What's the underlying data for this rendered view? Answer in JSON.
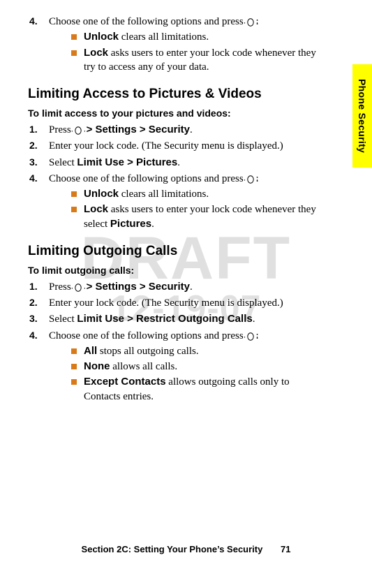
{
  "sideTab": "Phone Security",
  "watermark": {
    "line1": "DRAFT",
    "line2": "12-19-07"
  },
  "topBlock": {
    "step4": {
      "num": "4.",
      "text": "Choose one of the following options and press ",
      "after": ":"
    },
    "bullets": [
      {
        "bold": "Unlock",
        "rest": " clears all limitations."
      },
      {
        "bold": "Lock",
        "rest": " asks users to enter your lock code whenever they try to access any of your data."
      }
    ]
  },
  "sectionA": {
    "heading": "Limiting Access to Pictures & Videos",
    "subhead": "To limit access to your pictures and videos:",
    "steps": {
      "s1": {
        "num": "1.",
        "pre": "Press ",
        "path": " > Settings > Security",
        "end": "."
      },
      "s2": {
        "num": "2.",
        "text": "Enter your lock code. (The Security menu is displayed.)"
      },
      "s3": {
        "num": "3.",
        "pre": "Select ",
        "bold": "Limit Use > Pictures",
        "end": "."
      },
      "s4": {
        "num": "4.",
        "text": "Choose one of the following options and press ",
        "after": ":"
      }
    },
    "bullets": [
      {
        "bold": "Unlock",
        "rest": " clears all limitations."
      },
      {
        "bold": "Lock",
        "rest": " asks users to enter your lock code whenever they select ",
        "bold2": "Pictures",
        "end": "."
      }
    ]
  },
  "sectionB": {
    "heading": "Limiting Outgoing Calls",
    "subhead": "To limit outgoing calls:",
    "steps": {
      "s1": {
        "num": "1.",
        "pre": "Press ",
        "path": " > Settings > Security",
        "end": "."
      },
      "s2": {
        "num": "2.",
        "text": "Enter your lock code. (The Security menu is displayed.)"
      },
      "s3": {
        "num": "3.",
        "pre": "Select ",
        "bold": "Limit Use > Restrict Outgoing Calls",
        "end": "."
      },
      "s4": {
        "num": "4.",
        "text": "Choose one of the following options and press ",
        "after": ":"
      }
    },
    "bullets": [
      {
        "bold": "All",
        "rest": " stops all outgoing calls."
      },
      {
        "bold": "None",
        "rest": " allows all calls."
      },
      {
        "bold": "Except Contacts",
        "rest": " allows outgoing calls only to Contacts entries."
      }
    ]
  },
  "footer": {
    "text": "Section 2C: Setting Your Phone’s Security",
    "page": "71"
  }
}
